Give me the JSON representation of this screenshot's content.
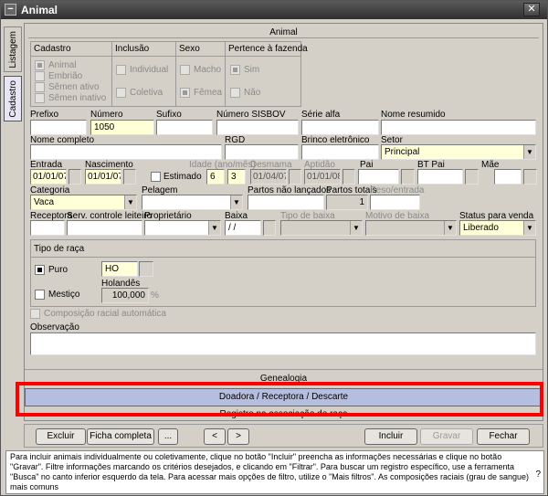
{
  "window": {
    "title": "Animal"
  },
  "sidetabs": [
    "Listagem",
    "Cadastro"
  ],
  "section_title": "Animal",
  "cadastro_group": {
    "label": "Cadastro",
    "options": [
      "Animal",
      "Embrião",
      "Sêmen ativo",
      "Sêmen inativo"
    ]
  },
  "inclusao_group": {
    "label": "Inclusão",
    "options": [
      "Individual",
      "Coletiva"
    ]
  },
  "sexo_group": {
    "label": "Sexo",
    "options": [
      "Macho",
      "Fêmea"
    ]
  },
  "fazenda_group": {
    "label": "Pertence à fazenda",
    "options": [
      "Sim",
      "Não"
    ]
  },
  "row1": {
    "prefixo_label": "Prefixo",
    "prefixo": "",
    "numero_label": "Número",
    "numero": "1050",
    "sufixo_label": "Sufixo",
    "sufixo": "",
    "sisbov_label": "Número SISBOV",
    "sisbov": "",
    "serie_label": "Série alfa",
    "serie": "",
    "nome_resumido_label": "Nome resumido",
    "nome_resumido": ""
  },
  "row2": {
    "nome_completo_label": "Nome completo",
    "nome_completo": "",
    "rgd_label": "RGD",
    "rgd": "",
    "brinco_label": "Brinco eletrônico",
    "brinco": "",
    "setor_label": "Setor",
    "setor": "Principal"
  },
  "row3": {
    "entrada_label": "Entrada",
    "entrada": "01/01/07",
    "nascimento_label": "Nascimento",
    "nascimento": "01/01/07",
    "estimado_label": "Estimado",
    "idade_label": "Idade (ano/mês)",
    "idade_ano": "6",
    "idade_mes": "3",
    "desmama_label": "Desmama",
    "desmama": "01/04/07",
    "aptidao_label": "Aptidão",
    "aptidao": "01/01/08",
    "pai_label": "Pai",
    "bt_pai_label": "BT Pai",
    "mae_label": "Mãe"
  },
  "row4": {
    "categoria_label": "Categoria",
    "categoria": "Vaca",
    "pelagem_label": "Pelagem",
    "pelagem": "",
    "partos_nao_label": "Partos não lançados",
    "partos_nao": "",
    "partos_totais_label": "Partos totais",
    "partos_totais": "1",
    "peso_entrada_label": "Peso/entrada",
    "peso_entrada": ""
  },
  "row5": {
    "receptora_label": "Receptora",
    "serv_label": "Serv. controle leiteiro",
    "proprietario_label": "Proprietário",
    "baixa_label": "Baixa",
    "baixa": "/ /",
    "tipo_baixa_label": "Tipo de baixa",
    "motivo_baixa_label": "Motivo de baixa",
    "status_label": "Status para venda",
    "status": "Liberado"
  },
  "raca": {
    "label": "Tipo de raça",
    "puro_label": "Puro",
    "puro_value": "HO",
    "mestico_label": "Mestiço",
    "holandes_label": "Holandês",
    "holandes_value": "100,000",
    "percent": "%"
  },
  "composicao_label": "Composição racial automática",
  "observacao_label": "Observação",
  "bars": {
    "genealogia": "Genealogia",
    "selected": "Doadora / Receptora / Descarte",
    "registro": "Registro na associação de raça"
  },
  "buttons": {
    "excluir": "Excluir",
    "ficha": "Ficha completa",
    "mais": "...",
    "prev": "<",
    "next": ">",
    "incluir": "Incluir",
    "gravar": "Gravar",
    "fechar": "Fechar"
  },
  "help_text": "Para incluir animais individualmente ou coletivamente, clique no botão \"Incluir\" preencha as informações necessárias e clique no botão \"Gravar\". Filtre informações marcando os critérios desejados, e clicando em \"Filtrar\". Para buscar um registro específico, use a ferramenta \"Busca\" no canto inferior esquerdo da tela. Para acessar mais opções de filtro, utilize o \"Mais filtros\". As composições raciais (grau de sangue) mais comuns",
  "help_icon": "?"
}
